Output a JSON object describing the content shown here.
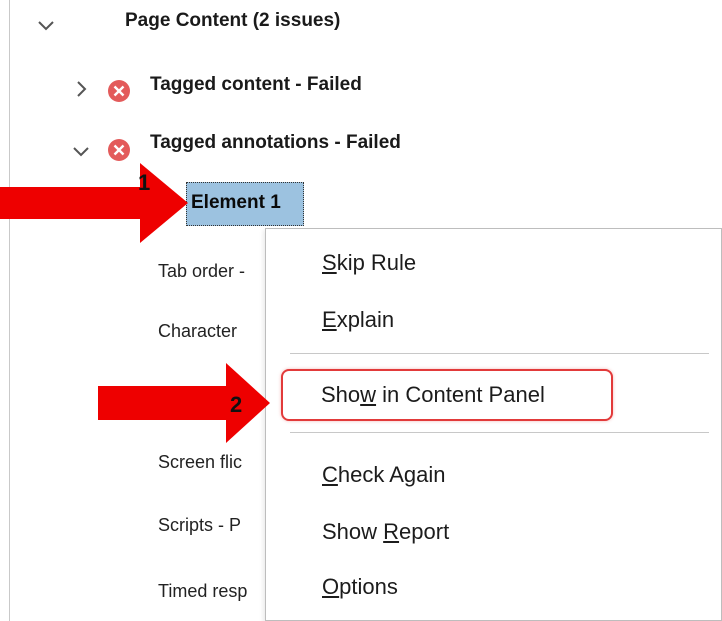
{
  "tree": {
    "group": {
      "label": "Page Content (2 issues)"
    },
    "items": [
      {
        "label": "Tagged content - Failed",
        "expanded": false,
        "status": "failed"
      },
      {
        "label": "Tagged annotations - Failed",
        "expanded": true,
        "status": "failed"
      }
    ],
    "selected": {
      "label": "Element 1"
    },
    "partial_rows": [
      "Tab order -",
      "Character",
      "Screen flic",
      "Scripts - P",
      "Timed resp"
    ]
  },
  "context_menu": {
    "items": [
      {
        "pre": "",
        "ul": "S",
        "post": "kip Rule"
      },
      {
        "pre": "",
        "ul": "E",
        "post": "xplain"
      },
      {
        "pre": "Sho",
        "ul": "w",
        "post": " in Content Panel"
      },
      {
        "pre": "",
        "ul": "C",
        "post": "heck Again"
      },
      {
        "pre": "Show ",
        "ul": "R",
        "post": "eport"
      },
      {
        "pre": "",
        "ul": "O",
        "post": "ptions"
      }
    ]
  },
  "annotations": {
    "arrow1_label": "1",
    "arrow2_label": "2",
    "arrow_color": "#ee0000",
    "highlight_color": "#e23a3a"
  },
  "colors": {
    "selection": "#9cc2e0",
    "error_icon": "#e35b5b"
  }
}
